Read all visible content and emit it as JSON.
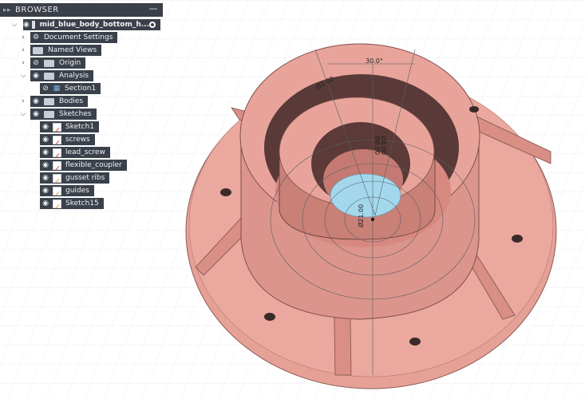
{
  "browser": {
    "title": "BROWSER",
    "minimize_label": "—",
    "root": {
      "label": "mid_blue_body_bottom_h..."
    },
    "items": [
      {
        "label": "Document Settings",
        "icon": "gear-icon"
      },
      {
        "label": "Named Views",
        "icon": "folder-icon"
      },
      {
        "label": "Origin",
        "icon": "folder-icon"
      },
      {
        "label": "Analysis",
        "icon": "folder-icon"
      },
      {
        "label": "Section1",
        "icon": "section-analysis-icon"
      },
      {
        "label": "Bodies",
        "icon": "folder-icon"
      },
      {
        "label": "Sketches",
        "icon": "folder-icon"
      }
    ],
    "sketches": [
      {
        "label": "Sketch1"
      },
      {
        "label": "screws"
      },
      {
        "label": "lead_screw"
      },
      {
        "label": "flexible_coupler"
      },
      {
        "label": "gusset ribs"
      },
      {
        "label": "guides"
      },
      {
        "label": "Sketch15"
      }
    ]
  },
  "viewport": {
    "dimensions": {
      "angle": "30.0°",
      "d1": "Ø2.00",
      "d2": "Ø8.00",
      "d3": "Ø6.00",
      "d4": "Ø21.00"
    },
    "colors": {
      "body": "#e8a49b",
      "body_dark": "#c9837b",
      "inner_blue": "#9fd6ea",
      "grid": "#dfe3e8"
    }
  }
}
